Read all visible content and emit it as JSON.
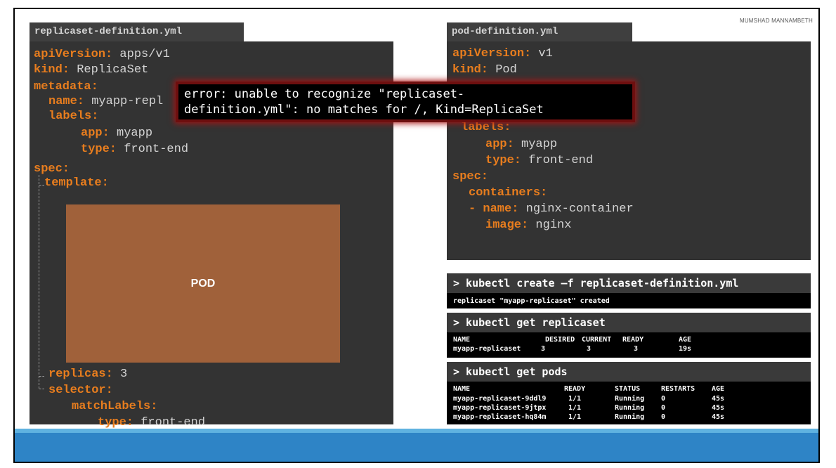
{
  "author": "MUMSHAD MANNAMBETH",
  "replicaset_file": {
    "tab_label": "replicaset-definition.yml",
    "lines": [
      {
        "key": "apiVersion:",
        "value": " apps/v1"
      },
      {
        "key": "kind:",
        "value": " ReplicaSet"
      },
      {
        "key": "metadata:",
        "value": ""
      },
      {
        "key": "name:",
        "value": " myapp-repl"
      },
      {
        "key": "labels:",
        "value": ""
      },
      {
        "key": "app:",
        "value": " myapp"
      },
      {
        "key": "type:",
        "value": " front-end"
      },
      {
        "key": "spec:",
        "value": ""
      },
      {
        "key": "template:",
        "value": ""
      },
      {
        "key": "replicas:",
        "value": " 3"
      },
      {
        "key": "selector:",
        "value": ""
      },
      {
        "key": "matchLabels:",
        "value": ""
      },
      {
        "key": "type:",
        "value": " front-end"
      }
    ],
    "pod_label": "POD"
  },
  "pod_file": {
    "tab_label": "pod-definition.yml",
    "lines": [
      {
        "key": "apiVersion:",
        "value": " v1"
      },
      {
        "key": "kind:",
        "value": " Pod"
      },
      {
        "key": "labels:",
        "value": ""
      },
      {
        "key": "app:",
        "value": " myapp"
      },
      {
        "key": "type:",
        "value": " front-end"
      },
      {
        "key": "spec:",
        "value": ""
      },
      {
        "key": "containers:",
        "value": ""
      },
      {
        "key": "- name:",
        "value": " nginx-container"
      },
      {
        "key": "image:",
        "value": " nginx"
      }
    ]
  },
  "error": {
    "line1": "error: unable to recognize \"replicaset-",
    "line2": "definition.yml\": no matches for /, Kind=ReplicaSet"
  },
  "terminal": {
    "cmd_create": "> kubectl create –f replicaset-definition.yml",
    "create_output": "replicaset \"myapp-replicaset\" created",
    "cmd_get_rs": "> kubectl get replicaset",
    "rs_headers": [
      "NAME",
      "DESIRED",
      "CURRENT",
      "READY",
      "AGE"
    ],
    "rs_rows": [
      [
        "myapp-replicaset",
        "3",
        "3",
        "3",
        "19s"
      ]
    ],
    "cmd_get_pods": "> kubectl get pods",
    "pod_headers": [
      "NAME",
      "READY",
      "STATUS",
      "RESTARTS",
      "AGE"
    ],
    "pod_rows": [
      [
        "myapp-replicaset-9ddl9",
        "1/1",
        "Running",
        "0",
        "45s"
      ],
      [
        "myapp-replicaset-9jtpx",
        "1/1",
        "Running",
        "0",
        "45s"
      ],
      [
        "myapp-replicaset-hq84m",
        "1/1",
        "Running",
        "0",
        "45s"
      ]
    ]
  },
  "colors": {
    "yaml_key": "#e87d1e",
    "yaml_value": "#d4d4d4",
    "pod_box": "#a0613a",
    "band": "#2e84c6"
  }
}
